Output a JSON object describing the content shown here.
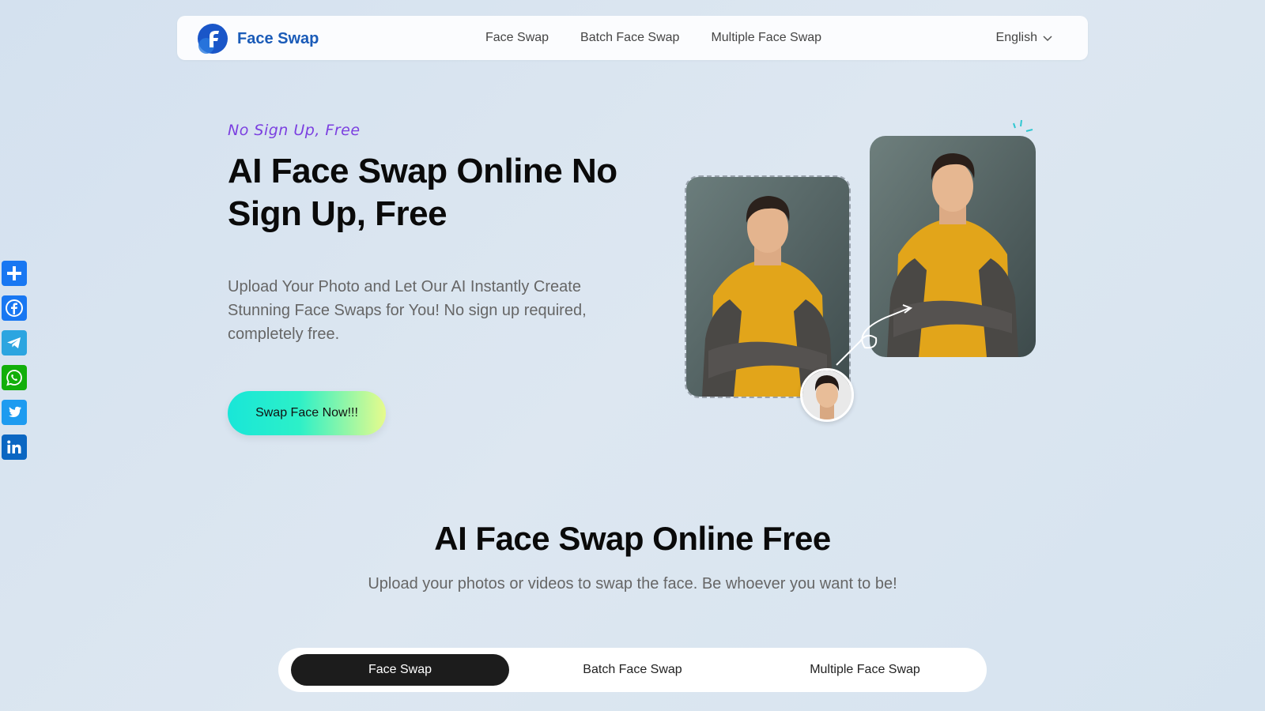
{
  "header": {
    "brand": "Face Swap",
    "logo_icon": "face-swap-logo-icon",
    "nav": [
      {
        "label": "Face Swap"
      },
      {
        "label": "Batch Face Swap"
      },
      {
        "label": "Multiple Face Swap"
      }
    ],
    "language": "English"
  },
  "share": {
    "buttons": [
      {
        "name": "share-add",
        "icon": "plus-icon",
        "color": "#1877f2"
      },
      {
        "name": "facebook",
        "icon": "facebook-icon",
        "color": "#1877f2"
      },
      {
        "name": "telegram",
        "icon": "telegram-icon",
        "color": "#2ca5e0"
      },
      {
        "name": "whatsapp",
        "icon": "whatsapp-icon",
        "color": "#12af0a"
      },
      {
        "name": "twitter",
        "icon": "twitter-icon",
        "color": "#1d9bf0"
      },
      {
        "name": "linkedin",
        "icon": "linkedin-icon",
        "color": "#0a66c2"
      }
    ]
  },
  "hero": {
    "tagline": "No Sign Up, Free",
    "title": "AI Face Swap Online No Sign Up, Free",
    "description": "Upload Your Photo and Let Our AI Instantly Create Stunning Face Swaps for You! No sign up required, completely free.",
    "cta": "Swap Face Now!!!"
  },
  "section": {
    "title": "AI Face Swap Online Free",
    "subtitle": "Upload your photos or videos to swap the face. Be whoever you want to be!"
  },
  "tabs": [
    {
      "label": "Face Swap",
      "active": true
    },
    {
      "label": "Batch Face Swap",
      "active": false
    },
    {
      "label": "Multiple Face Swap",
      "active": false
    }
  ],
  "colors": {
    "brand": "#1a5bb8",
    "tagline": "#7b3fe0",
    "active_tab": "#1c1c1c"
  }
}
